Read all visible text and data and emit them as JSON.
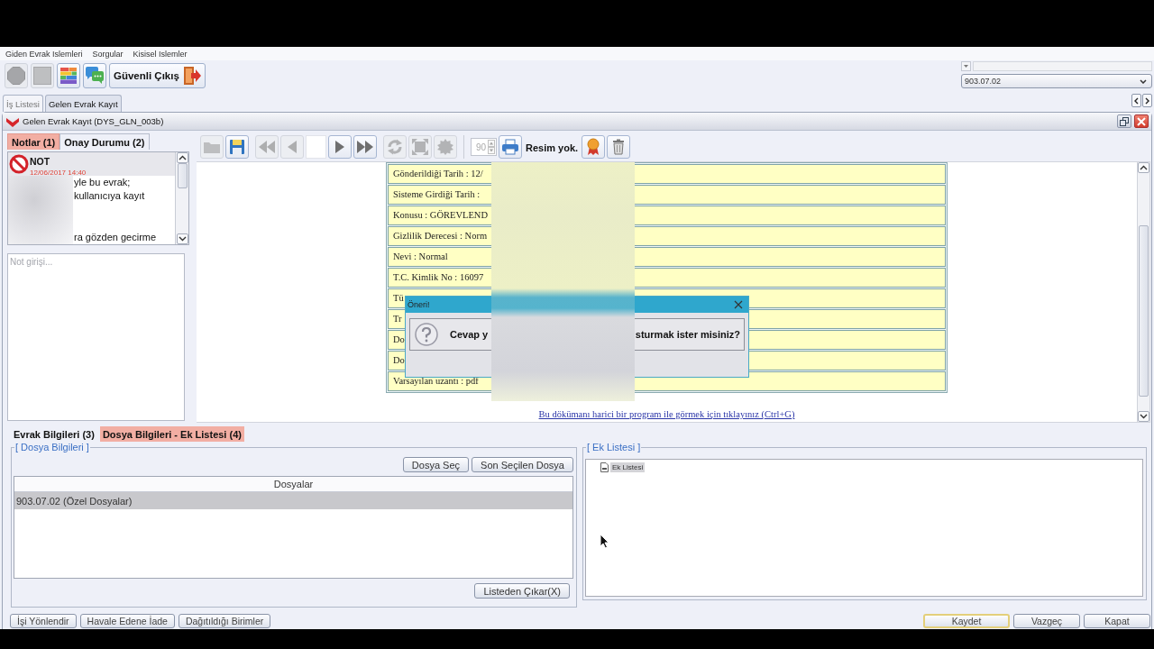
{
  "menu_bar": [
    "Giden Evrak Islemleri",
    "Sorgular",
    "Kisisel Islemler"
  ],
  "toolbar": {
    "icon_buttons": [
      {
        "disabled": true
      },
      {
        "disabled": true
      },
      {
        "disabled": false
      },
      {
        "disabled": false
      }
    ],
    "exit_button": "Güvenli Çıkış"
  },
  "unit_selector": {
    "value": "903.07.02"
  },
  "tabs": [
    {
      "label": "İş Listesi",
      "selected": false
    },
    {
      "label": "Gelen Evrak Kayıt",
      "selected": true
    }
  ],
  "window": {
    "title": "Gelen Evrak Kayıt (DYS_GLN_003b)"
  },
  "notes_panel": {
    "tabs": [
      {
        "label": "Notlar (1)",
        "selected": true
      },
      {
        "label": "Onay Durumu (2)",
        "selected": false
      }
    ],
    "notes": [
      {
        "title": "NOT",
        "date": "12/06/2017 14:40",
        "lines": [
          "yle bu evrak;",
          "kullanıcıya kayıt",
          "ra gözden gecirme"
        ]
      }
    ],
    "note_input": {
      "placeholder": "Not girişi..."
    }
  },
  "viewer_toolbar": {
    "file_buttons": [
      {
        "disabled": true
      },
      {
        "disabled": false
      }
    ],
    "back_buttons": [
      {
        "disabled": true
      },
      {
        "disabled": true
      }
    ],
    "forward_buttons": [
      {
        "disabled": false
      },
      {
        "disabled": false
      }
    ],
    "view_buttons": [
      {
        "disabled": true
      },
      {
        "disabled": true
      },
      {
        "disabled": true
      }
    ],
    "zoom_spinner": {
      "value": "90",
      "disabled": true
    },
    "print_button": {
      "disabled": false
    },
    "image_status": "Resim yok.",
    "end_buttons": [
      {
        "disabled": false
      },
      {
        "disabled": false
      }
    ]
  },
  "document": {
    "fields": [
      "Gönderildiği Tarih : 12/",
      "Sisteme Girdiği Tarih :",
      "Konusu : GÖREVLEND",
      "Gizlilik Derecesi : Norm",
      "Nevi : Normal",
      "T.C. Kimlik No : 16097",
      "Tü",
      "Tr",
      "Do",
      "Do",
      "Varsayılan uzantı : pdf"
    ],
    "link": "Bu dökümanı harici bir program ile görmek için tıklayınız (Ctrl+G)"
  },
  "dialog": {
    "title": "Öneri!",
    "message_start": "Cevap y",
    "message_end": "sturmak ister misiniz?"
  },
  "bottom_tabs": [
    {
      "label": "Evrak Bilgileri (3)",
      "selected": false
    },
    {
      "label": "Dosya Bilgileri - Ek Listesi (4)",
      "selected": true
    }
  ],
  "file_group": {
    "title": "[ Dosya Bilgileri ]",
    "buttons": [
      "Dosya Seç",
      "Son Seçilen Dosya"
    ],
    "table": {
      "columns": [
        "Dosyalar"
      ],
      "rows": [
        {
          "cells": [
            "903.07.02 (Özel Dosyalar)"
          ],
          "selected": true
        }
      ]
    },
    "remove_button": "Listeden Çıkar(X)"
  },
  "attachment_group": {
    "title": "[ Ek Listesi ]",
    "tree": [
      {
        "label": "Ek Listesi",
        "selected": true
      }
    ]
  },
  "footer": {
    "left_buttons": [
      "İşi Yönlendir",
      "Havale Edene İade",
      "Dağıtıldığı Birimler"
    ],
    "right_buttons": [
      {
        "label": "Kaydet",
        "focused": true
      },
      {
        "label": "Vazgeç",
        "focused": false
      },
      {
        "label": "Kapat",
        "focused": false
      }
    ]
  }
}
